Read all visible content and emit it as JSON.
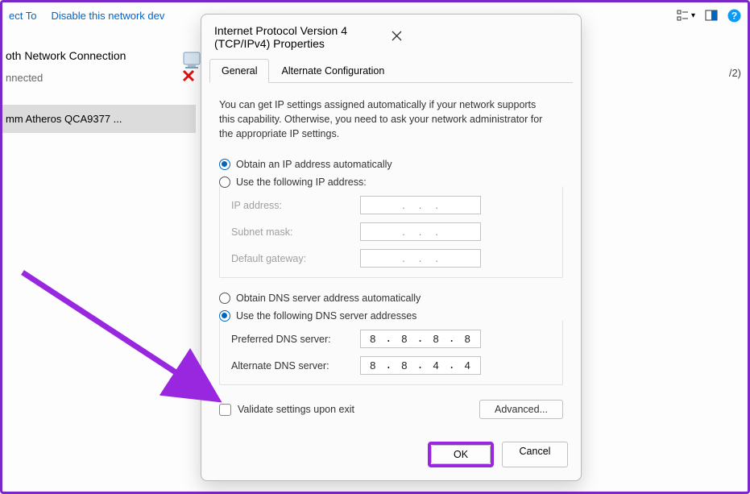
{
  "bg": {
    "toolbar": {
      "connect_to": "ect To",
      "disable_device": "Disable this network dev"
    },
    "panel": {
      "title": "oth Network Connection",
      "status": "nnected",
      "item": "mm Atheros QCA9377 ..."
    },
    "right_text": "/2)"
  },
  "dialog": {
    "title": "Internet Protocol Version 4 (TCP/IPv4) Properties",
    "tabs": {
      "general": "General",
      "alternate": "Alternate Configuration"
    },
    "intro": "You can get IP settings assigned automatically if your network supports this capability. Otherwise, you need to ask your network administrator for the appropriate IP settings.",
    "ip": {
      "auto_label": "Obtain an IP address automatically",
      "manual_label": "Use the following IP address:",
      "fields": {
        "ip_address": "IP address:",
        "subnet_mask": "Subnet mask:",
        "default_gateway": "Default gateway:"
      }
    },
    "dns": {
      "auto_label": "Obtain DNS server address automatically",
      "manual_label": "Use the following DNS server addresses",
      "preferred_label": "Preferred DNS server:",
      "alternate_label": "Alternate DNS server:",
      "preferred": [
        "8",
        "8",
        "8",
        "8"
      ],
      "alternate": [
        "8",
        "8",
        "4",
        "4"
      ]
    },
    "validate_label": "Validate settings upon exit",
    "advanced_label": "Advanced...",
    "ok_label": "OK",
    "cancel_label": "Cancel"
  }
}
